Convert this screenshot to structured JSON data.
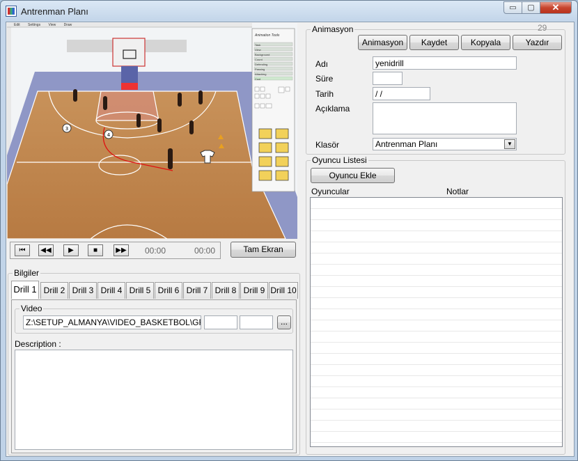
{
  "window": {
    "title": "Antrenman Planı",
    "minimize": "▭",
    "maximize": "▢",
    "close": "✕"
  },
  "court": {
    "menu": [
      "Edit",
      "Settings",
      "View",
      "Draw"
    ],
    "tools_title": "Animation Tools",
    "tool_items": [
      "Task",
      "View",
      "Background",
      "Count",
      "Defending",
      "Passing",
      "Attacking",
      "Cool"
    ],
    "player_numbers": [
      "3",
      "4"
    ]
  },
  "player": {
    "time_current": "00:00",
    "time_total": "00:00",
    "fullscreen_label": "Tam Ekran"
  },
  "info": {
    "group_label": "Bilgiler",
    "tabs": [
      "Drill 1",
      "Drill 2",
      "Drill 3",
      "Drill 4",
      "Drill 5",
      "Drill 6",
      "Drill 7",
      "Drill 8",
      "Drill 9",
      "Drill 10"
    ],
    "active_tab": "Drill 1",
    "video_label": "Video",
    "video_path": "Z:\\SETUP_ALMANYA\\VIDEO_BASKETBOL\\GRECEE",
    "browse_label": "...",
    "description_label": "Description :"
  },
  "animation": {
    "group_label": "Animasyon",
    "counter": "29",
    "buttons": [
      "Animasyon",
      "Kaydet",
      "Kopyala",
      "Yazdır"
    ],
    "name_label": "Adı",
    "name_value": "yenidrill",
    "duration_label": "Süre",
    "duration_value": "",
    "date_label": "Tarih",
    "date_value": " /  /",
    "description_label": "Açıklama",
    "folder_label": "Klasör",
    "folder_value": "Antrenman Planı"
  },
  "players": {
    "group_label": "Oyuncu Listesi",
    "add_button": "Oyuncu Ekle",
    "col_players": "Oyuncular",
    "col_notes": "Notlar"
  }
}
